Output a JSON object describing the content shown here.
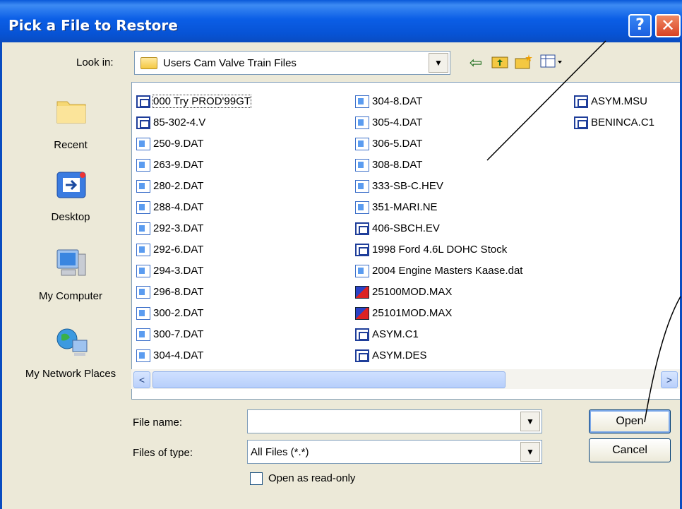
{
  "window": {
    "title": "Pick a File to Restore",
    "help_glyph": "?",
    "close_glyph": "✕"
  },
  "lookin": {
    "label": "Look in:",
    "value": "Users Cam Valve Train Files"
  },
  "places": [
    {
      "label": "Recent",
      "icon": "recent-folder-icon"
    },
    {
      "label": "Desktop",
      "icon": "desktop-icon"
    },
    {
      "label": "My Computer",
      "icon": "my-computer-icon"
    },
    {
      "label": "My Network Places",
      "icon": "network-places-icon"
    }
  ],
  "files": {
    "col1": [
      {
        "name": "000 Try PROD'99GT",
        "type": "exe"
      },
      {
        "name": "85-302-4.V",
        "type": "exe"
      },
      {
        "name": "250-9.DAT",
        "type": "dat"
      },
      {
        "name": "263-9.DAT",
        "type": "dat"
      },
      {
        "name": "280-2.DAT",
        "type": "dat"
      },
      {
        "name": "288-4.DAT",
        "type": "dat"
      },
      {
        "name": "292-3.DAT",
        "type": "dat"
      },
      {
        "name": "292-6.DAT",
        "type": "dat"
      },
      {
        "name": "294-3.DAT",
        "type": "dat"
      },
      {
        "name": "296-8.DAT",
        "type": "dat"
      },
      {
        "name": "300-2.DAT",
        "type": "dat"
      },
      {
        "name": "300-7.DAT",
        "type": "dat"
      },
      {
        "name": "304-4.DAT",
        "type": "dat"
      }
    ],
    "col2": [
      {
        "name": "304-8.DAT",
        "type": "dat"
      },
      {
        "name": "305-4.DAT",
        "type": "dat"
      },
      {
        "name": "306-5.DAT",
        "type": "dat"
      },
      {
        "name": "308-8.DAT",
        "type": "dat"
      },
      {
        "name": "333-SB-C.HEV",
        "type": "dat"
      },
      {
        "name": "351-MARI.NE",
        "type": "dat"
      },
      {
        "name": "406-SBCH.EV",
        "type": "exe"
      },
      {
        "name": "1998 Ford 4.6L DOHC Stock",
        "type": "exe"
      },
      {
        "name": "2004 Engine Masters Kaase.dat",
        "type": "dat"
      },
      {
        "name": "25100MOD.MAX",
        "type": "max"
      },
      {
        "name": "25101MOD.MAX",
        "type": "max"
      },
      {
        "name": "ASYM.C1",
        "type": "exe"
      },
      {
        "name": "ASYM.DES",
        "type": "exe"
      }
    ],
    "col3": [
      {
        "name": "ASYM.MSU",
        "type": "exe"
      },
      {
        "name": "BENINCA.C1",
        "type": "exe"
      }
    ]
  },
  "filename": {
    "label": "File name:",
    "value": ""
  },
  "filetype": {
    "label": "Files of type:",
    "value": "All Files (*.*)"
  },
  "readonly": {
    "label": "Open as read-only",
    "checked": false
  },
  "buttons": {
    "open": "Open",
    "cancel": "Cancel"
  },
  "scroll": {
    "left_glyph": "<",
    "right_glyph": ">"
  },
  "colors": {
    "title_bar": "#0a5ad9",
    "dialog_bg": "#ece9d8",
    "close_red": "#d84224"
  }
}
